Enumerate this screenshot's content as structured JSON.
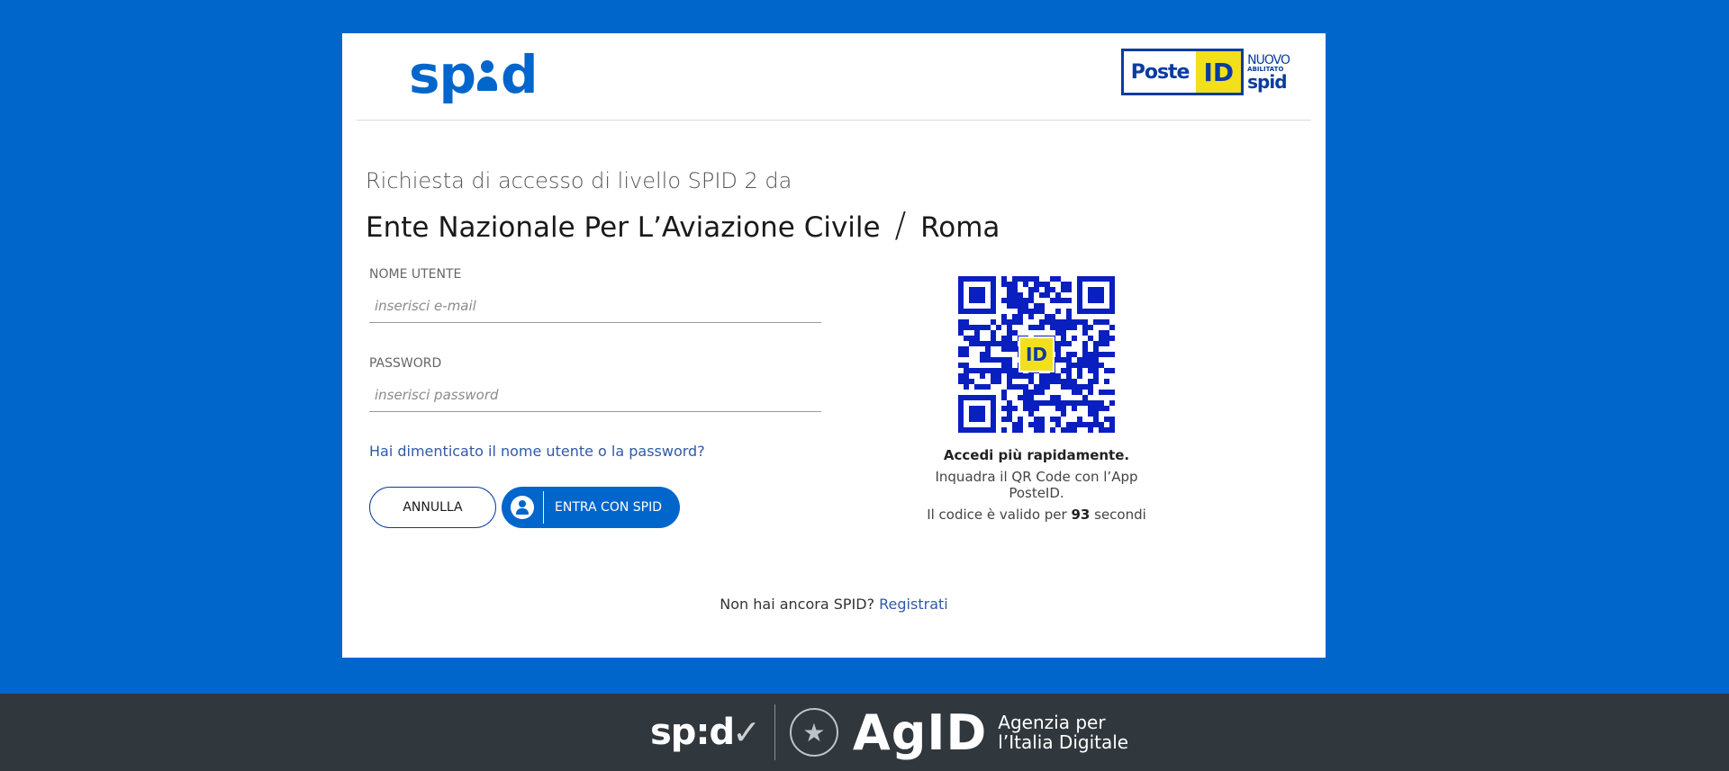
{
  "header": {
    "spid_logo": {
      "before": "sp",
      "after": "d"
    },
    "posteid_logo": {
      "poste": "Poste",
      "id": "ID",
      "nuovo": "NUOVO",
      "abilitato": "ABILITATO",
      "spid": "spid"
    }
  },
  "request": {
    "line": "Richiesta di accesso di livello SPID 2 da",
    "entity": "Ente Nazionale Per L’Aviazione Civile",
    "separator": "/",
    "city": "Roma"
  },
  "form": {
    "username_label": "NOME UTENTE",
    "username_placeholder": "inserisci e-mail",
    "password_label": "PASSWORD",
    "password_placeholder": "inserisci password",
    "forgot_link": "Hai dimenticato il nome utente o la password?",
    "cancel_button": "ANNULLA",
    "login_button": "ENTRA CON SPID"
  },
  "qr": {
    "badge": "ID",
    "title": "Accedi più rapidamente.",
    "instruction": "Inquadra il QR Code con l’App PosteID.",
    "validity_prefix": "Il codice è valido per",
    "seconds": "93",
    "validity_suffix": "secondi"
  },
  "register": {
    "question": "Non hai ancora SPID?",
    "link": "Registrati"
  },
  "footer": {
    "spid": "sp:d",
    "agid": "AgID",
    "agency_line1": "Agenzia per",
    "agency_line2": "l’Italia Digitale"
  },
  "colors": {
    "background": "#0066cc",
    "primary": "#0066cc",
    "link": "#2f5aa8",
    "poste_yellow": "#f2e01c",
    "poste_blue": "#0a3ca0",
    "footer": "#30373d"
  }
}
